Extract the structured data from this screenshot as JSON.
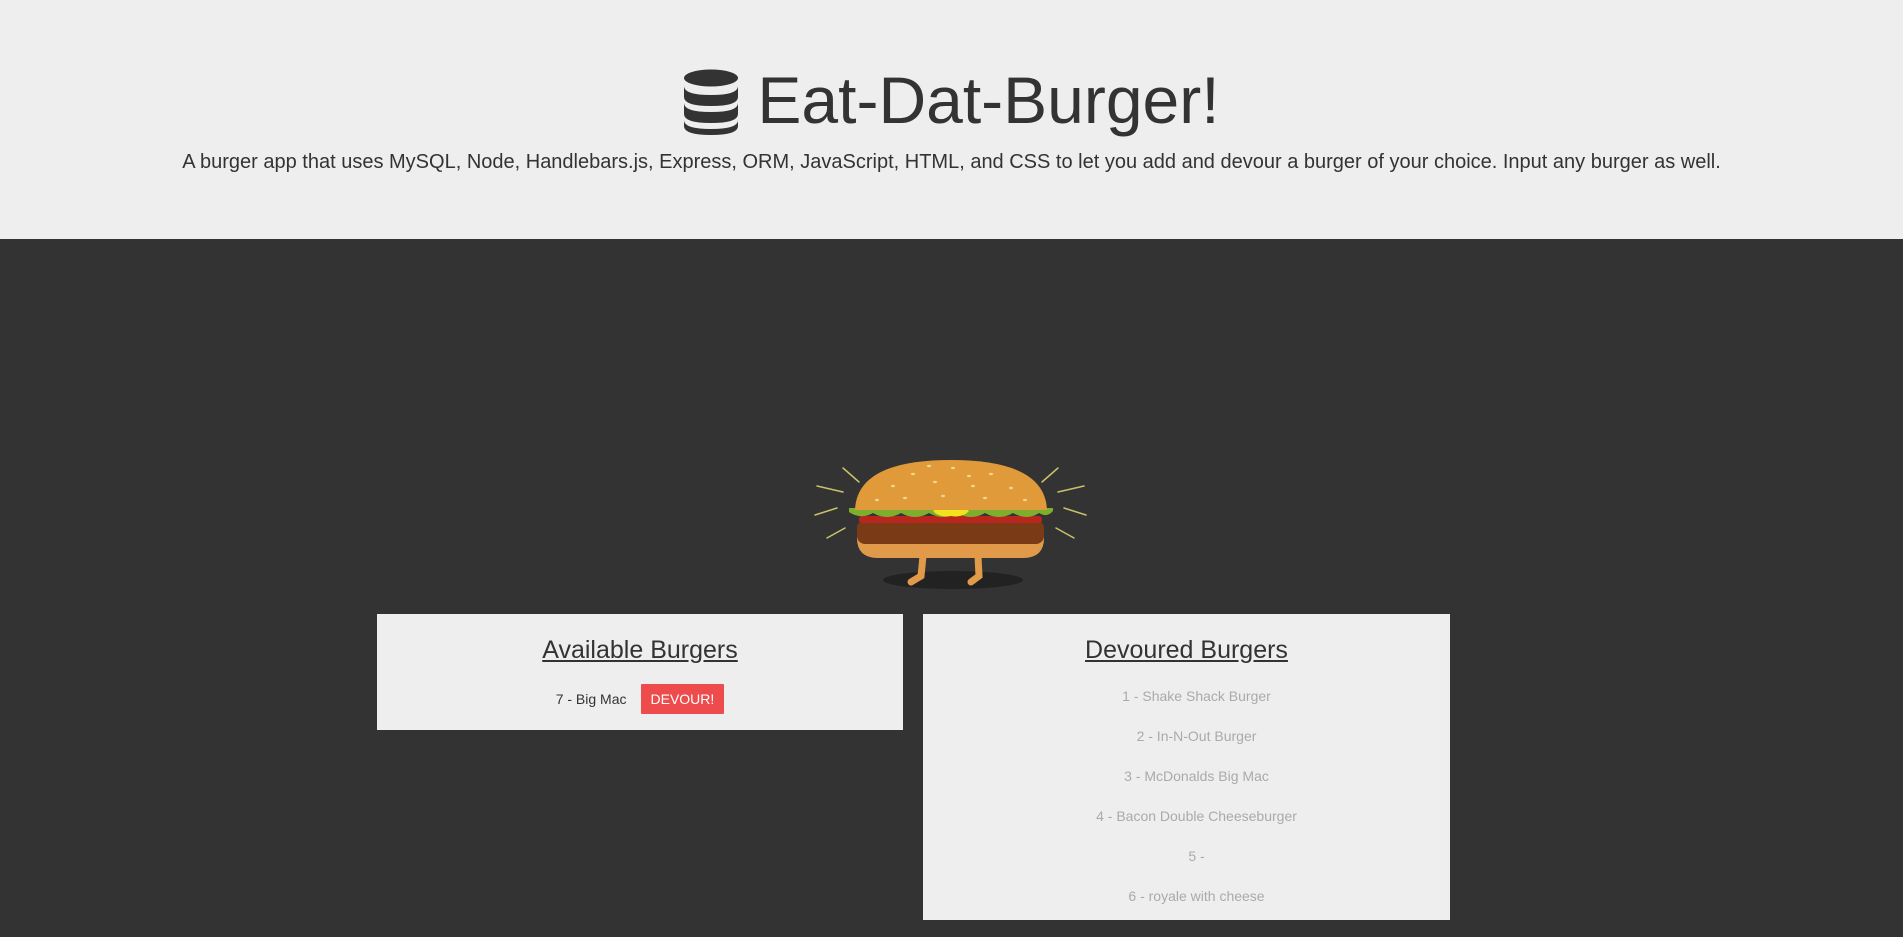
{
  "header": {
    "icon": "database-icon",
    "title": "Eat-Dat-Burger!",
    "description": "A burger app that uses MySQL, Node, Handlebars.js, Express, ORM, JavaScript, HTML, and CSS to let you add and devour a burger of your choice. Input any burger as well."
  },
  "illustration": "burger-illustration",
  "available": {
    "heading": "Available Burgers",
    "items": [
      {
        "label": "7 - Big Mac",
        "button_label": "DEVOUR!"
      }
    ]
  },
  "devoured": {
    "heading": "Devoured Burgers",
    "items": [
      {
        "label": "1 - Shake Shack Burger"
      },
      {
        "label": "2 - In-N-Out Burger"
      },
      {
        "label": "3 - McDonalds Big Mac"
      },
      {
        "label": "4 - Bacon Double Cheeseburger"
      },
      {
        "label": "5 - "
      },
      {
        "label": "6 - royale with cheese"
      }
    ]
  },
  "colors": {
    "page_background": "#333333",
    "header_background": "#eeeeee",
    "devour_button": "#ee4c4c",
    "devoured_text": "#aaaaaa"
  }
}
